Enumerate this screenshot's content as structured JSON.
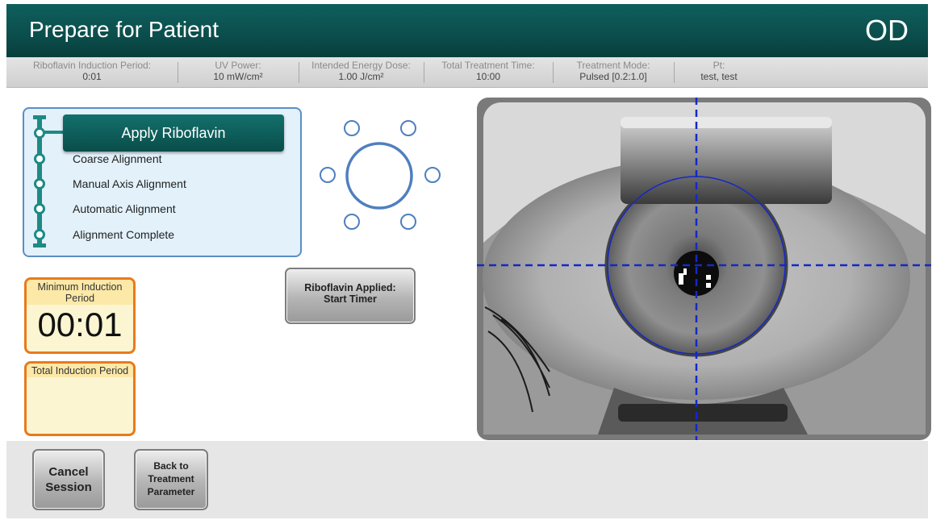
{
  "header": {
    "title": "Prepare for Patient",
    "eye": "OD"
  },
  "params": [
    {
      "label": "Riboflavin Induction Period:",
      "value": "0:01"
    },
    {
      "label": "UV Power:",
      "value": "10 mW/cm²"
    },
    {
      "label": "Intended Energy Dose:",
      "value": "1.00 J/cm²"
    },
    {
      "label": "Total Treatment Time:",
      "value": "10:00"
    },
    {
      "label": "Treatment Mode:",
      "value": "Pulsed [0.2:1.0]"
    },
    {
      "label": "Pt:",
      "value": "test, test"
    }
  ],
  "steps": {
    "active": "Apply Riboflavin",
    "items": [
      "Coarse Alignment",
      "Manual Axis Alignment",
      "Automatic Alignment",
      "Alignment Complete"
    ]
  },
  "timers": {
    "minimum": {
      "label": "Minimum Induction Period",
      "value": "00:01"
    },
    "total": {
      "label": "Total Induction Period",
      "value": ""
    }
  },
  "buttons": {
    "start_timer_line1": "Riboflavin Applied:",
    "start_timer_line2": "Start Timer",
    "cancel_line1": "Cancel",
    "cancel_line2": "Session",
    "back_line1": "Back to",
    "back_line2": "Treatment",
    "back_line3": "Parameter"
  },
  "colors": {
    "header_teal": "#0b4e4c",
    "step_rail": "#1e8a84",
    "panel_border": "#5b8ec6",
    "timer_border": "#e87a1c",
    "crosshair": "#1428c8"
  }
}
